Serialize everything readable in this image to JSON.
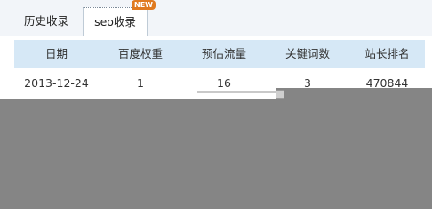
{
  "tabs": [
    {
      "label": "历史收录"
    },
    {
      "label": "seo收录",
      "badge": "NEW"
    }
  ],
  "table": {
    "columns": [
      "日期",
      "百度权重",
      "预估流量",
      "关键词数",
      "站长排名"
    ],
    "rows": [
      [
        "2013-12-24",
        "1",
        "16",
        "3",
        "470844"
      ]
    ]
  },
  "colors": {
    "header_bg": "#d6e8f6",
    "badge": "#e07a1f",
    "overlay": "#858585"
  }
}
